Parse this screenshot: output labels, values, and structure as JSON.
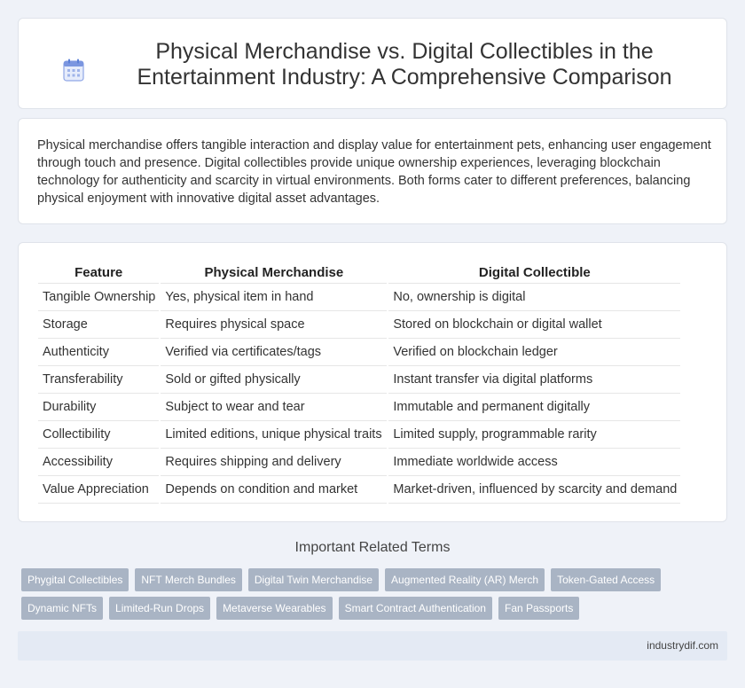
{
  "page": {
    "title": "Physical Merchandise vs. Digital Collectibles in the Entertainment Industry: A Comprehensive Comparison",
    "title_icon": "calendar-icon",
    "description": "Physical merchandise offers tangible interaction and display value for entertainment pets, enhancing user engagement through touch and presence. Digital collectibles provide unique ownership experiences, leveraging blockchain technology for authenticity and scarcity in virtual environments. Both forms cater to different preferences, balancing physical enjoyment with innovative digital asset advantages."
  },
  "table": {
    "headers": [
      "Feature",
      "Physical Merchandise",
      "Digital Collectible"
    ],
    "rows": [
      [
        "Tangible Ownership",
        "Yes, physical item in hand",
        "No, ownership is digital"
      ],
      [
        "Storage",
        "Requires physical space",
        "Stored on blockchain or digital wallet"
      ],
      [
        "Authenticity",
        "Verified via certificates/tags",
        "Verified on blockchain ledger"
      ],
      [
        "Transferability",
        "Sold or gifted physically",
        "Instant transfer via digital platforms"
      ],
      [
        "Durability",
        "Subject to wear and tear",
        "Immutable and permanent digitally"
      ],
      [
        "Collectibility",
        "Limited editions, unique physical traits",
        "Limited supply, programmable rarity"
      ],
      [
        "Accessibility",
        "Requires shipping and delivery",
        "Immediate worldwide access"
      ],
      [
        "Value Appreciation",
        "Depends on condition and market",
        "Market-driven, influenced by scarcity and demand"
      ]
    ]
  },
  "related": {
    "title": "Important Related Terms",
    "tags_row1": [
      "Phygital Collectibles",
      "NFT Merch Bundles",
      "Digital Twin Merchandise",
      "Augmented Reality (AR) Merch",
      "Token-Gated Access"
    ],
    "tags_row2": [
      "Dynamic NFTs",
      "Limited-Run Drops",
      "Metaverse Wearables",
      "Smart Contract Authentication",
      "Fan Passports"
    ]
  },
  "footer": {
    "site": "industrydif.com"
  },
  "colors": {
    "accent": "#5b7fd6",
    "tag_bg": "#a9b4c4",
    "footer_bg": "#e4eaf4",
    "page_bg": "#eff2f8"
  }
}
